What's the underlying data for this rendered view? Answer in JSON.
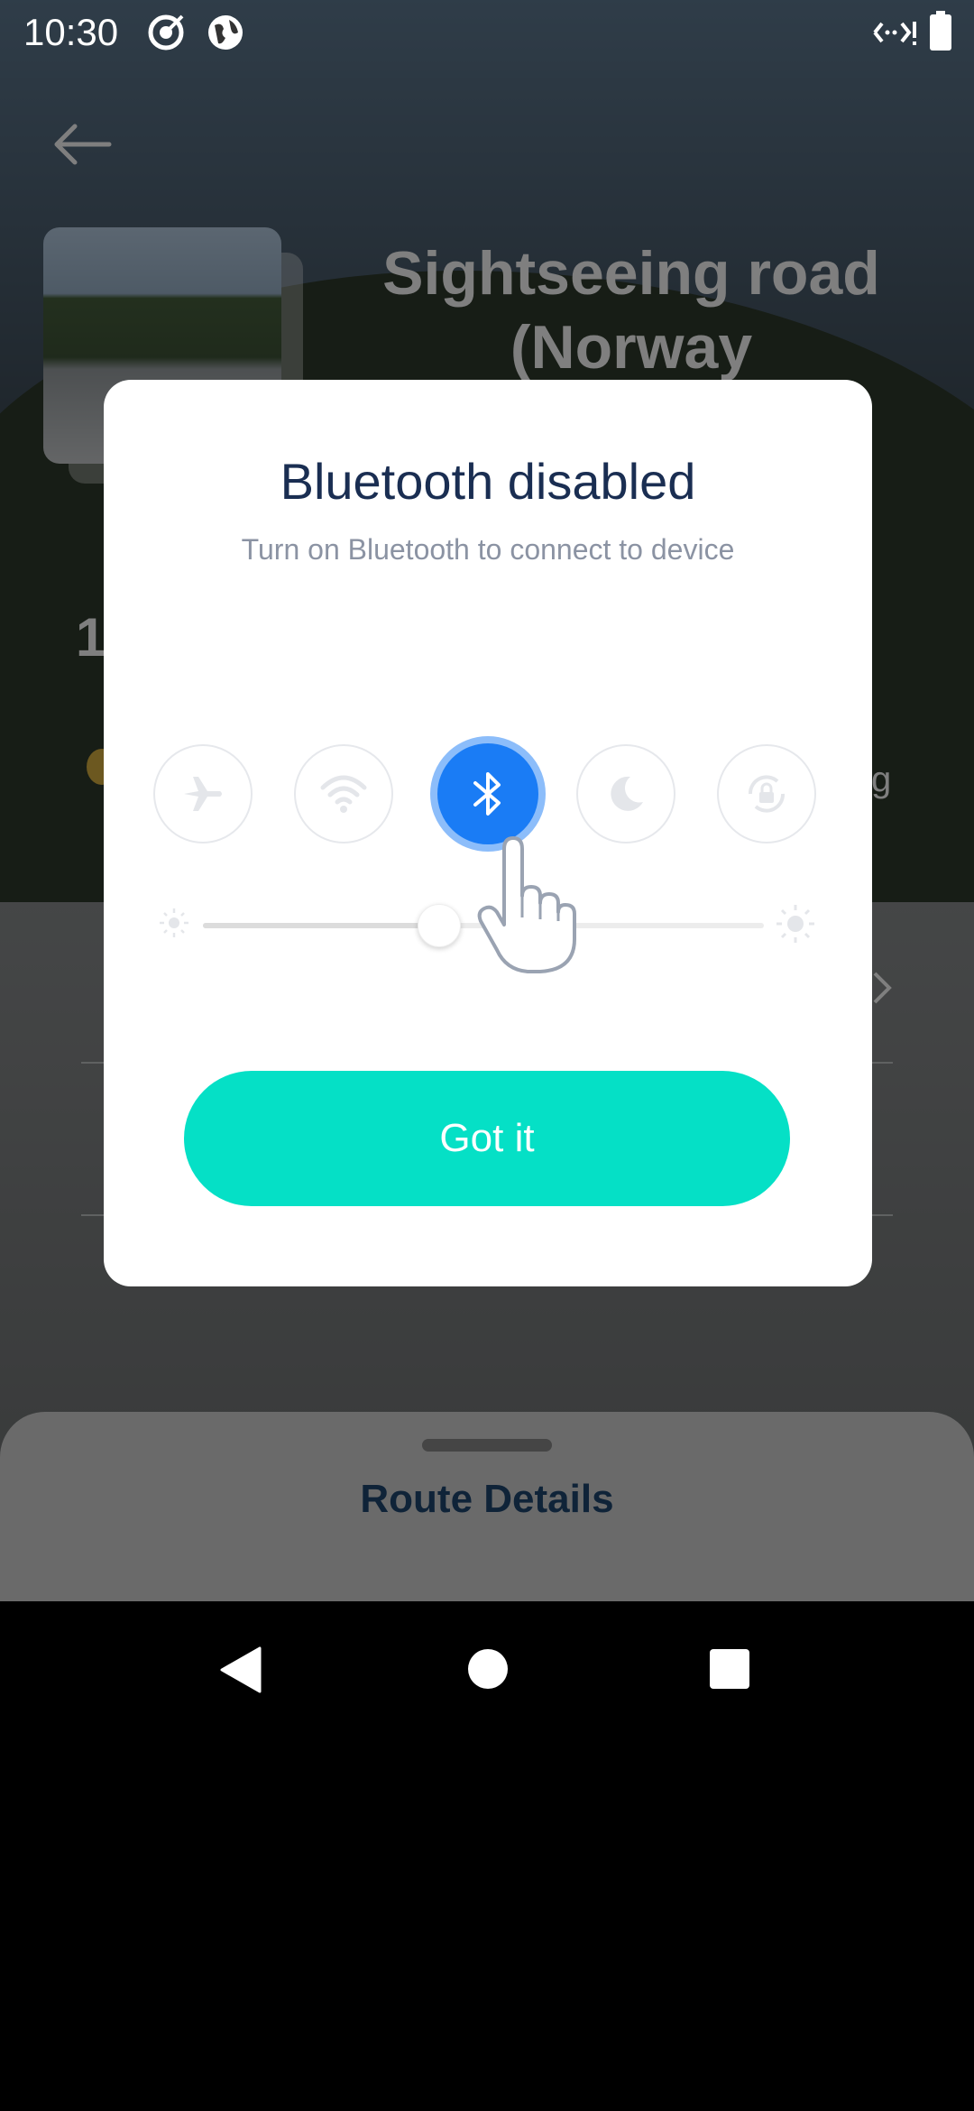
{
  "status_bar": {
    "time": "10:30"
  },
  "background": {
    "route_title": "Sightseeing road (Norway",
    "fragment_number": "1",
    "fragment_letter": "g"
  },
  "dialog": {
    "title": "Bluetooth disabled",
    "subtitle": "Turn on Bluetooth to connect to device",
    "toggles": [
      {
        "icon": "airplane-icon",
        "active": false
      },
      {
        "icon": "wifi-icon",
        "active": false
      },
      {
        "icon": "bluetooth-icon",
        "active": true
      },
      {
        "icon": "moon-icon",
        "active": false
      },
      {
        "icon": "rotation-lock-icon",
        "active": false
      }
    ],
    "brightness_level": 0.42,
    "confirm_label": "Got it",
    "colors": {
      "accent": "#05e0c6",
      "bluetooth_active": "#1a7cf5",
      "title": "#1a2e52"
    }
  },
  "bottom_sheet": {
    "title": "Route Details"
  }
}
